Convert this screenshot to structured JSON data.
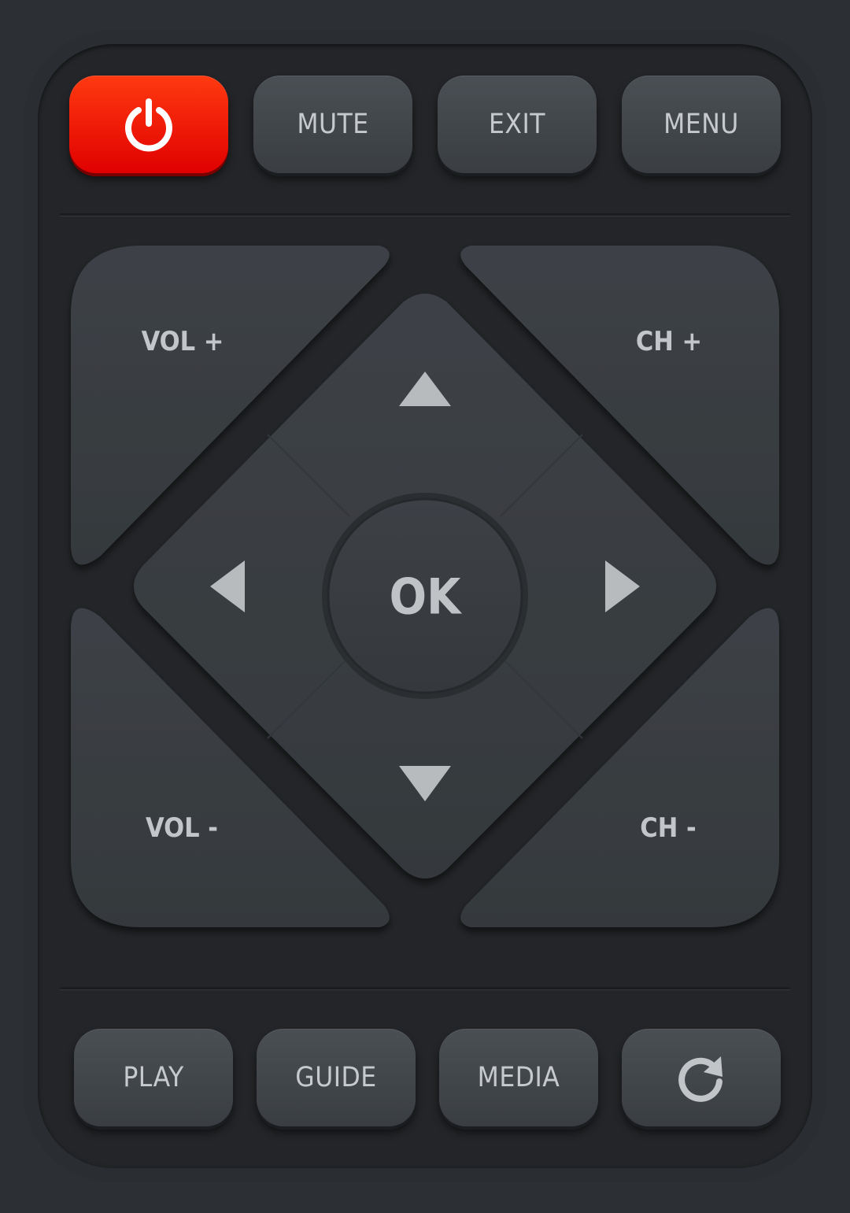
{
  "top_row": {
    "power": {
      "icon": "power-icon",
      "color": "#ff2a00"
    },
    "mute_label": "MUTE",
    "exit_label": "EXIT",
    "menu_label": "MENU"
  },
  "control_pad": {
    "vol_up_label": "VOL +",
    "vol_down_label": "VOL -",
    "ch_up_label": "CH +",
    "ch_down_label": "CH -",
    "ok_label": "OK",
    "arrows": [
      "arrow-up-icon",
      "arrow-left-icon",
      "arrow-right-icon",
      "arrow-down-icon"
    ]
  },
  "bottom_row": {
    "play_label": "PLAY",
    "guide_label": "GUIDE",
    "media_label": "MEDIA",
    "refresh": {
      "icon": "refresh-icon"
    }
  },
  "colors": {
    "background": "#2c3034",
    "body": "#232528",
    "button": "#42464b",
    "text": "#c7cacd",
    "power": "#ff2a00"
  }
}
